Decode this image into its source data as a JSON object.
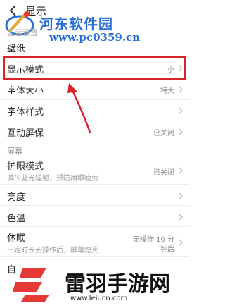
{
  "header": {
    "title": "显示",
    "back_icon": "chevron-left-icon"
  },
  "watermark_top": {
    "title": "河东软件园",
    "url": "www.pc0359.cn",
    "color": "#2a6fd6"
  },
  "sections": {
    "display_settings_header": "显示设置",
    "screen_header": "屏幕"
  },
  "rows": {
    "wallpaper": {
      "label": "壁纸"
    },
    "display_mode": {
      "label": "显示模式",
      "value": "小"
    },
    "font_size": {
      "label": "字体大小",
      "value": "特大"
    },
    "font_style": {
      "label": "字体样式"
    },
    "interactive_screensaver": {
      "label": "互动屏保",
      "value": "已关闭"
    },
    "eye_protection": {
      "label": "护眼模式",
      "sub": "减少蓝光辐射，预防用眼疲劳",
      "value": "已关闭"
    },
    "brightness": {
      "label": "亮度"
    },
    "color_temp": {
      "label": "色温"
    },
    "sleep": {
      "label": "休眠",
      "sub": "一定时长无操作后，屏幕熄灭",
      "value_line1": "无操作 10 分",
      "value_line2": "钟后"
    },
    "auto": {
      "label": "自"
    }
  },
  "highlight_color": "#d8232a",
  "watermark_bottom": {
    "title": "雷羽手游网",
    "url": "www.leiucn.com"
  }
}
